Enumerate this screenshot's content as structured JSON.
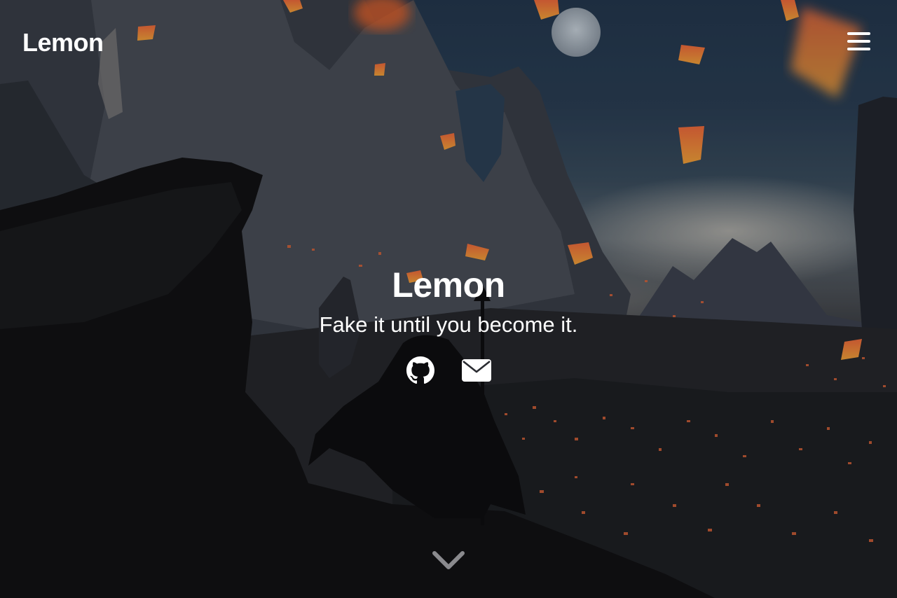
{
  "header": {
    "site_title": "Lemon",
    "menu_icon": "hamburger-menu-icon"
  },
  "hero": {
    "title": "Lemon",
    "subtitle": "Fake it until you become it.",
    "social": [
      {
        "icon": "github-icon"
      },
      {
        "icon": "mail-icon"
      }
    ],
    "scroll_icon": "chevron-down-icon"
  },
  "colors": {
    "text": "#ffffff",
    "sky": "#24384f",
    "lantern": "#e8642a",
    "ground": "#0d0d0f"
  }
}
